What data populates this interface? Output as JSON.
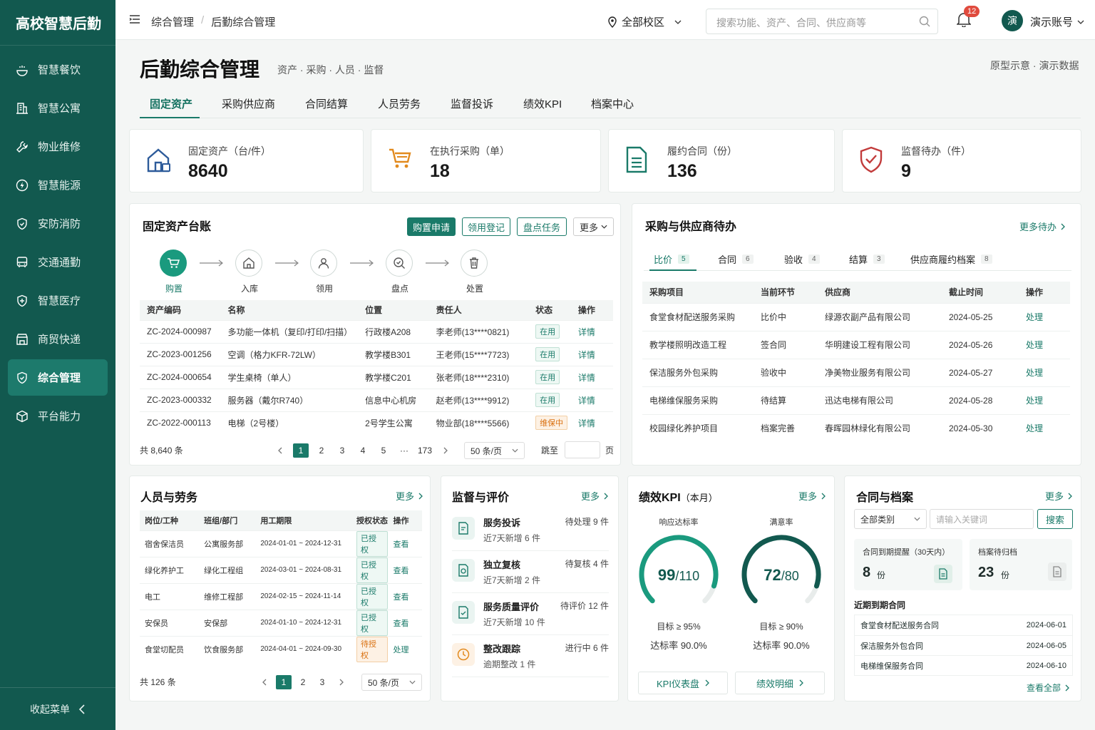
{
  "app": {
    "brand": "高校智慧后勤",
    "collapse": "收起菜单"
  },
  "sidebar": {
    "items": [
      {
        "label": "智慧餐饮",
        "icon": "dining-icon"
      },
      {
        "label": "智慧公寓",
        "icon": "building-icon"
      },
      {
        "label": "物业维修",
        "icon": "wrench-icon"
      },
      {
        "label": "智慧能源",
        "icon": "energy-icon"
      },
      {
        "label": "安防消防",
        "icon": "shield-icon"
      },
      {
        "label": "交通通勤",
        "icon": "bus-icon"
      },
      {
        "label": "智慧医疗",
        "icon": "medical-icon"
      },
      {
        "label": "商贸快递",
        "icon": "shop-icon"
      },
      {
        "label": "综合管理",
        "icon": "shield-check-icon",
        "active": true
      },
      {
        "label": "平台能力",
        "icon": "cube-icon"
      }
    ]
  },
  "topbar": {
    "crumb1": "综合管理",
    "crumb_sep": "/",
    "crumb2": "后勤综合管理",
    "campus": "全部校区",
    "search_placeholder": "搜索功能、资产、合同、供应商等",
    "notif_count": "12",
    "avatar": "演",
    "account": "演示账号"
  },
  "header": {
    "title": "后勤综合管理",
    "subtitle": "资产 · 采购 · 人员 · 监督",
    "note": "原型示意 · 演示数据"
  },
  "tabs": [
    "固定资产",
    "采购供应商",
    "合同结算",
    "人员劳务",
    "监督投诉",
    "绩效KPI",
    "档案中心"
  ],
  "stats": [
    {
      "label": "固定资产（台/件）",
      "value": "8640",
      "icon": "house-icon"
    },
    {
      "label": "在执行采购（单）",
      "value": "18",
      "icon": "cart-icon"
    },
    {
      "label": "履约合同（份）",
      "value": "136",
      "icon": "document-icon"
    },
    {
      "label": "监督待办（件）",
      "value": "9",
      "icon": "shield-check-icon"
    }
  ],
  "assets": {
    "title": "固定资产台账",
    "btn_apply": "购置申请",
    "btn_use": "领用登记",
    "btn_check": "盘点任务",
    "btn_more": "更多",
    "flow": [
      "购置",
      "入库",
      "领用",
      "盘点",
      "处置"
    ],
    "headers": [
      "资产编码",
      "名称",
      "位置",
      "责任人",
      "状态",
      "操作"
    ],
    "rows": [
      [
        "ZC-2024-000987",
        "多功能一体机（复印/打印/扫描）",
        "行政楼A208",
        "李老师(13****0821)",
        "在用",
        "详情"
      ],
      [
        "ZC-2023-001256",
        "空调（格力KFR-72LW）",
        "教学楼B301",
        "王老师(15****7723)",
        "在用",
        "详情"
      ],
      [
        "ZC-2024-000654",
        "学生桌椅（单人）",
        "教学楼C201",
        "张老师(18****2310)",
        "在用",
        "详情"
      ],
      [
        "ZC-2023-000332",
        "服务器（戴尔R740）",
        "信息中心机房",
        "赵老师(13****9912)",
        "在用",
        "详情"
      ],
      [
        "ZC-2022-000113",
        "电梯（2号楼）",
        "2号学生公寓",
        "物业部(18****5566)",
        "维保中",
        "详情"
      ]
    ],
    "total": "共 8,640 条",
    "pages": [
      "1",
      "2",
      "3",
      "4",
      "5",
      "···",
      "173"
    ],
    "page_size": "50 条/页",
    "jump": "跳至",
    "page_unit": "页"
  },
  "procurement": {
    "title": "采购与供应商待办",
    "more": "更多待办",
    "tabs": [
      {
        "label": "比价",
        "count": "5"
      },
      {
        "label": "合同",
        "count": "6"
      },
      {
        "label": "验收",
        "count": "4"
      },
      {
        "label": "结算",
        "count": "3"
      },
      {
        "label": "供应商履约档案",
        "count": "8"
      }
    ],
    "headers": [
      "采购项目",
      "当前环节",
      "供应商",
      "截止时间",
      "操作"
    ],
    "rows": [
      [
        "食堂食材配送服务采购",
        "比价中",
        "绿源农副产品有限公司",
        "2024-05-25",
        "处理"
      ],
      [
        "教学楼照明改造工程",
        "签合同",
        "华明建设工程有限公司",
        "2024-05-26",
        "处理"
      ],
      [
        "保洁服务外包采购",
        "验收中",
        "净美物业服务有限公司",
        "2024-05-27",
        "处理"
      ],
      [
        "电梯维保服务采购",
        "待结算",
        "迅达电梯有限公司",
        "2024-05-28",
        "处理"
      ],
      [
        "校园绿化养护项目",
        "档案完善",
        "春晖园林绿化有限公司",
        "2024-05-30",
        "处理"
      ]
    ]
  },
  "staff": {
    "title": "人员与劳务",
    "more": "更多",
    "headers": [
      "岗位/工种",
      "班组/部门",
      "用工期限",
      "授权状态",
      "操作"
    ],
    "rows": [
      [
        "宿舍保洁员",
        "公寓服务部",
        "2024-01-01 ~ 2024-12-31",
        "已授权",
        "查看"
      ],
      [
        "绿化养护工",
        "绿化工程组",
        "2024-03-01 ~ 2024-08-31",
        "已授权",
        "查看"
      ],
      [
        "电工",
        "维修工程部",
        "2024-02-15 ~ 2024-11-14",
        "已授权",
        "查看"
      ],
      [
        "安保员",
        "安保部",
        "2024-01-10 ~ 2024-12-31",
        "已授权",
        "查看"
      ],
      [
        "食堂切配员",
        "饮食服务部",
        "2024-04-01 ~ 2024-09-30",
        "待授权",
        "处理"
      ]
    ],
    "total": "共 126 条",
    "pages": [
      "1",
      "2",
      "3"
    ],
    "page_size": "50 条/页"
  },
  "supervision": {
    "title": "监督与评价",
    "more": "更多",
    "items": [
      {
        "name": "服务投诉",
        "status": "待处理 9 件",
        "sub": "近7天新增 6 件",
        "icon": "complaint-icon"
      },
      {
        "name": "独立复核",
        "status": "待复核 4 件",
        "sub": "近7天新增 2 件",
        "icon": "review-icon"
      },
      {
        "name": "服务质量评价",
        "status": "待评价 12 件",
        "sub": "近7天新增 10 件",
        "icon": "rating-icon"
      },
      {
        "name": "整改跟踪",
        "status": "进行中 6 件",
        "sub": "逾期整改 1 件",
        "icon": "clock-icon"
      }
    ]
  },
  "kpi": {
    "title": "绩效KPI",
    "period": "（本月）",
    "more": "更多",
    "gauges": [
      {
        "label": "响应达标率",
        "value": "99",
        "total": "/110",
        "target": "目标 ≥ 95%",
        "rate": "达标率  90.0%",
        "fraction": 0.9
      },
      {
        "label": "满意率",
        "value": "72",
        "total": "/80",
        "target": "目标 ≥ 90%",
        "rate": "达标率  90.0%",
        "fraction": 0.9
      }
    ],
    "btn_board": "KPI仪表盘",
    "btn_detail": "绩效明细"
  },
  "contracts": {
    "title": "合同与档案",
    "more": "更多",
    "category": "全部类别",
    "keyword_placeholder": "请输入关键词",
    "search_btn": "搜索",
    "expire_label": "合同到期提醒（30天内）",
    "expire_value": "8",
    "expire_unit": "份",
    "archive_label": "档案待归档",
    "archive_value": "23",
    "archive_unit": "份",
    "recent_title": "近期到期合同",
    "recent": [
      [
        "食堂食材配送服务合同",
        "2024-06-01"
      ],
      [
        "保洁服务外包合同",
        "2024-06-05"
      ],
      [
        "电梯维保服务合同",
        "2024-06-10"
      ]
    ],
    "view_all": "查看全部"
  },
  "colors": {
    "primary": "#1a7a69",
    "sidebar": "#12594f",
    "warn": "#d9700f",
    "badge": "#e04b3e"
  }
}
